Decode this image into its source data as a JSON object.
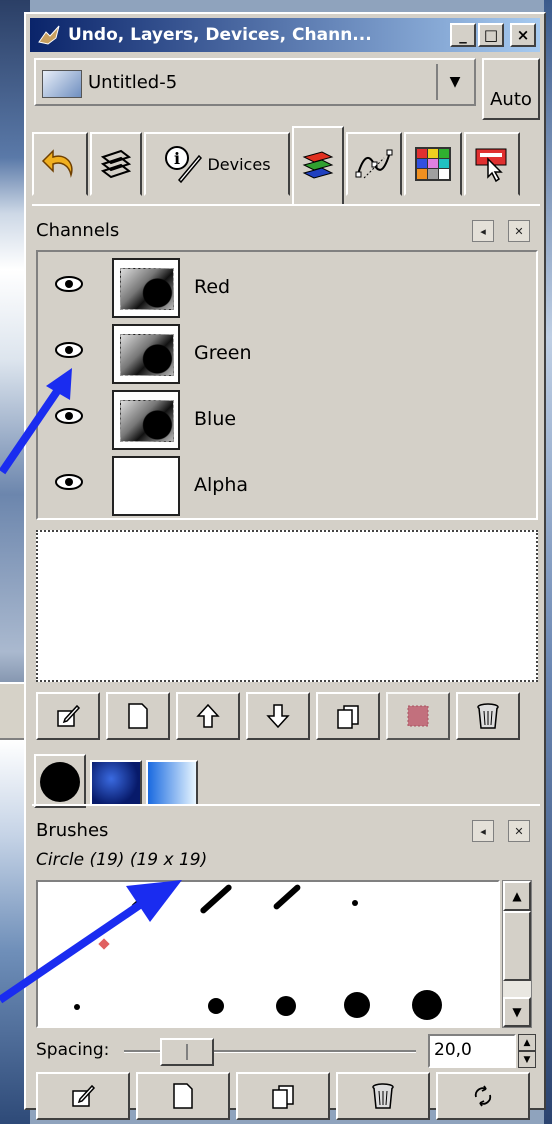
{
  "window": {
    "title": "Undo, Layers, Devices, Chann...",
    "minimize": "_",
    "maximize": "□",
    "close": "×"
  },
  "image_selector": {
    "value": "Untitled-5",
    "auto_label": "Auto"
  },
  "tabs": [
    {
      "icon": "undo-icon"
    },
    {
      "icon": "layers-icon"
    },
    {
      "icon": "devices-icon",
      "label": "Devices"
    },
    {
      "icon": "channels-icon",
      "active": true
    },
    {
      "icon": "paths-icon"
    },
    {
      "icon": "palette-grid-icon"
    },
    {
      "icon": "pointer-info-icon"
    }
  ],
  "channels_panel": {
    "title": "Channels",
    "channels": [
      {
        "name": "Red",
        "visible": true
      },
      {
        "name": "Green",
        "visible": true
      },
      {
        "name": "Blue",
        "visible": true
      },
      {
        "name": "Alpha",
        "visible": true
      }
    ],
    "toolbar": [
      "edit-icon",
      "new-icon",
      "raise-icon",
      "lower-icon",
      "duplicate-icon",
      "to-selection-icon",
      "delete-icon"
    ]
  },
  "brushes_panel": {
    "title": "Brushes",
    "selected_brush": "Circle (19) (19 x 19)",
    "spacing_label": "Spacing:",
    "spacing_value": "20,0",
    "toolbar": [
      "edit-icon",
      "new-icon",
      "duplicate-icon",
      "delete-icon",
      "refresh-icon"
    ]
  },
  "colors": {
    "title_start": "#0a246a",
    "title_end": "#a6caf0",
    "arrow": "#1a2cf0",
    "face": "#d4d0c8"
  }
}
